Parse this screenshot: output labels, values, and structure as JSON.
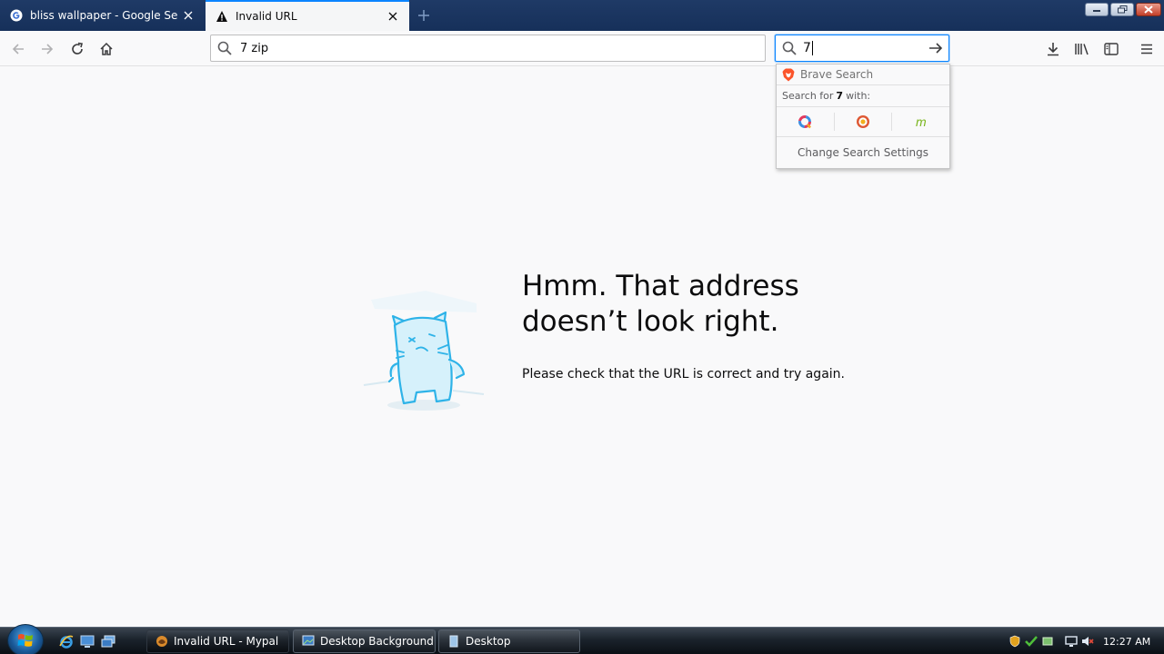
{
  "tabs": [
    {
      "title": "bliss wallpaper - Google Search",
      "favicon": "google-icon",
      "active": false
    },
    {
      "title": "Invalid URL",
      "favicon": "warning-icon",
      "active": true
    }
  ],
  "new_tab_icon": "plus-icon",
  "window_controls": [
    "minimize-icon",
    "restore-icon",
    "close-icon"
  ],
  "navbar": {
    "back_icon": "back-arrow-icon",
    "forward_icon": "forward-arrow-icon",
    "reload_icon": "reload-icon",
    "home_icon": "home-icon",
    "url_value": "7 zip",
    "search_value": "7",
    "right_icons": [
      "download-icon",
      "library-icon",
      "sidebar-icon",
      "hamburger-menu-icon"
    ]
  },
  "search_popup": {
    "engine_name": "Brave Search",
    "search_for_prefix": "Search for",
    "search_for_query": "7",
    "search_for_suffix": "with:",
    "engines": [
      "qwant-icon",
      "duckduckgo-icon",
      "mojeek-icon"
    ],
    "settings_label": "Change Search Settings"
  },
  "error_page": {
    "title": "Hmm. That address doesn’t look right.",
    "description": "Please check that the URL is correct and try again.",
    "illustration": "confused-cat-illustration"
  },
  "taskbar": {
    "buttons": [
      {
        "label": "Invalid URL - Mypal",
        "active": true
      },
      {
        "label": "Desktop Background",
        "active": false
      },
      {
        "label": "Desktop",
        "active": false
      }
    ],
    "clock": "12:27 AM"
  },
  "colors": {
    "accent": "#0a84ff",
    "tabbar": "#1f3a66",
    "page_bg": "#f9f9fa",
    "illustration": "#2eb3e8"
  }
}
